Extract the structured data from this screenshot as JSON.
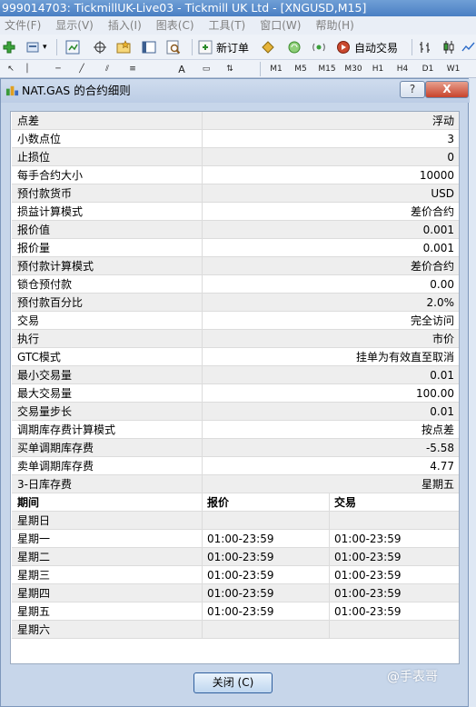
{
  "app": {
    "title": "999014703: TickmillUK-Live03 - Tickmill UK Ltd - [XNGUSD,M15]"
  },
  "menu": [
    "文件(F)",
    "显示(V)",
    "插入(I)",
    "图表(C)",
    "工具(T)",
    "窗口(W)",
    "帮助(H)"
  ],
  "toolbar": {
    "new_order": "新订单",
    "auto_trade": "自动交易",
    "timeframes": [
      "M1",
      "M5",
      "M15",
      "M30",
      "H1",
      "H4",
      "D1",
      "W1"
    ],
    "text_tool": "A"
  },
  "dialog": {
    "title": "NAT.GAS 的合约细则",
    "help_label": "?",
    "close_label": "X",
    "ok_label": "关闭 (C)"
  },
  "specs": [
    {
      "label": "点差",
      "value": "浮动"
    },
    {
      "label": "小数点位",
      "value": "3"
    },
    {
      "label": "止损位",
      "value": "0"
    },
    {
      "label": "每手合约大小",
      "value": "10000"
    },
    {
      "label": "预付款货币",
      "value": "USD"
    },
    {
      "label": "损益计算模式",
      "value": "差价合约"
    },
    {
      "label": "报价值",
      "value": "0.001"
    },
    {
      "label": "报价量",
      "value": "0.001"
    },
    {
      "label": "预付款计算模式",
      "value": "差价合约"
    },
    {
      "label": "锁仓预付款",
      "value": "0.00"
    },
    {
      "label": "预付款百分比",
      "value": "2.0%"
    },
    {
      "label": "交易",
      "value": "完全访问"
    },
    {
      "label": "执行",
      "value": "市价"
    },
    {
      "label": "GTC模式",
      "value": "挂单为有效直至取消"
    },
    {
      "label": "最小交易量",
      "value": "0.01"
    },
    {
      "label": "最大交易量",
      "value": "100.00"
    },
    {
      "label": "交易量步长",
      "value": "0.01"
    },
    {
      "label": "调期库存费计算模式",
      "value": "按点差"
    },
    {
      "label": "买单调期库存费",
      "value": "-5.58"
    },
    {
      "label": "卖单调期库存费",
      "value": "4.77"
    },
    {
      "label": "3-日库存费",
      "value": "星期五"
    }
  ],
  "sessions": {
    "headers": [
      "期间",
      "报价",
      "交易"
    ],
    "rows": [
      {
        "day": "星期日",
        "quote": "",
        "trade": ""
      },
      {
        "day": "星期一",
        "quote": "01:00-23:59",
        "trade": "01:00-23:59"
      },
      {
        "day": "星期二",
        "quote": "01:00-23:59",
        "trade": "01:00-23:59"
      },
      {
        "day": "星期三",
        "quote": "01:00-23:59",
        "trade": "01:00-23:59"
      },
      {
        "day": "星期四",
        "quote": "01:00-23:59",
        "trade": "01:00-23:59"
      },
      {
        "day": "星期五",
        "quote": "01:00-23:59",
        "trade": "01:00-23:59"
      },
      {
        "day": "星期六",
        "quote": "",
        "trade": ""
      }
    ]
  },
  "watermark": "@手表哥"
}
